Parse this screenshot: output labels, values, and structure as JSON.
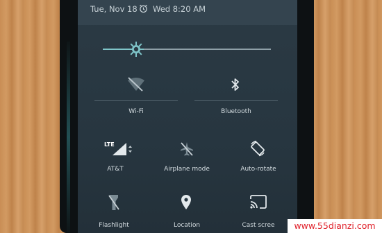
{
  "status": {
    "date": "Tue, Nov 18",
    "alarm": "Wed 8:20 AM"
  },
  "brightness": {
    "level": 0.2
  },
  "tiles": {
    "wifi": "Wi-Fi",
    "bluetooth": "Bluetooth",
    "lte_badge": "LTE",
    "carrier": "AT&T",
    "airplane": "Airplane mode",
    "autorotate": "Auto-rotate",
    "flashlight": "Flashlight",
    "location": "Location",
    "cast": "Cast scree"
  },
  "watermark": "www.55dianzi.com",
  "colors": {
    "panel": "#2b3a44",
    "accent": "#7fc5c9",
    "watermark_text": "#e0202a"
  }
}
